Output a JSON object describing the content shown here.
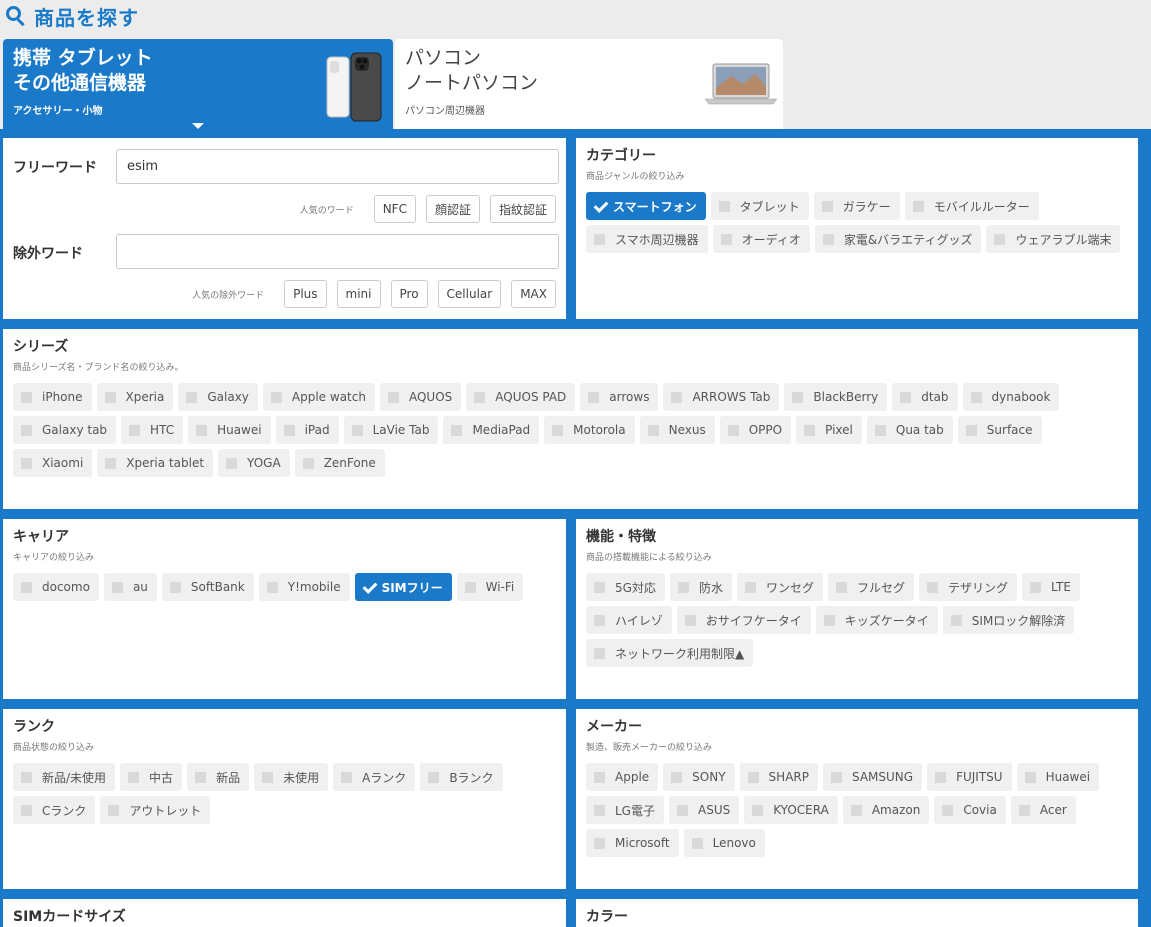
{
  "page": {
    "title": "商品を探す"
  },
  "tabs": [
    {
      "line1": "携帯 タブレット",
      "line2": "その他通信機器",
      "sub": "アクセサリー・小物"
    },
    {
      "line1": "パソコン",
      "line2": "ノートパソコン",
      "sub": "パソコン周辺機器"
    }
  ],
  "freeword": {
    "label": "フリーワード",
    "value": "esim",
    "popular_label": "人気のワード",
    "popular": [
      "NFC",
      "顔認証",
      "指紋認証"
    ],
    "exclude_label": "除外ワード",
    "exclude_value": "",
    "popular_exclude_label": "人気の除外ワード",
    "popular_exclude": [
      "Plus",
      "mini",
      "Pro",
      "Cellular",
      "MAX"
    ]
  },
  "sections": {
    "category": {
      "title": "カテゴリー",
      "sub": "商品ジャンルの絞り込み",
      "items": [
        {
          "label": "スマートフォン",
          "checked": true
        },
        {
          "label": "タブレット",
          "checked": false
        },
        {
          "label": "ガラケー",
          "checked": false
        },
        {
          "label": "モバイルルーター",
          "checked": false
        },
        {
          "label": "スマホ周辺機器",
          "checked": false
        },
        {
          "label": "オーディオ",
          "checked": false
        },
        {
          "label": "家電&バラエティグッズ",
          "checked": false
        },
        {
          "label": "ウェアラブル端末",
          "checked": false
        }
      ]
    },
    "series": {
      "title": "シリーズ",
      "sub": "商品シリーズ名・ブランド名の絞り込み。",
      "items": [
        {
          "label": "iPhone",
          "checked": false
        },
        {
          "label": "Xperia",
          "checked": false
        },
        {
          "label": "Galaxy",
          "checked": false
        },
        {
          "label": "Apple watch",
          "checked": false
        },
        {
          "label": "AQUOS",
          "checked": false
        },
        {
          "label": "AQUOS PAD",
          "checked": false
        },
        {
          "label": "arrows",
          "checked": false
        },
        {
          "label": "ARROWS Tab",
          "checked": false
        },
        {
          "label": "BlackBerry",
          "checked": false
        },
        {
          "label": "dtab",
          "checked": false
        },
        {
          "label": "dynabook",
          "checked": false
        },
        {
          "label": "Galaxy tab",
          "checked": false
        },
        {
          "label": "HTC",
          "checked": false
        },
        {
          "label": "Huawei",
          "checked": false
        },
        {
          "label": "iPad",
          "checked": false
        },
        {
          "label": "LaVie Tab",
          "checked": false
        },
        {
          "label": "MediaPad",
          "checked": false
        },
        {
          "label": "Motorola",
          "checked": false
        },
        {
          "label": "Nexus",
          "checked": false
        },
        {
          "label": "OPPO",
          "checked": false
        },
        {
          "label": "Pixel",
          "checked": false
        },
        {
          "label": "Qua tab",
          "checked": false
        },
        {
          "label": "Surface",
          "checked": false
        },
        {
          "label": "Xiaomi",
          "checked": false
        },
        {
          "label": "Xperia tablet",
          "checked": false
        },
        {
          "label": "YOGA",
          "checked": false
        },
        {
          "label": "ZenFone",
          "checked": false
        }
      ]
    },
    "carrier": {
      "title": "キャリア",
      "sub": "キャリアの絞り込み",
      "items": [
        {
          "label": "docomo",
          "checked": false
        },
        {
          "label": "au",
          "checked": false
        },
        {
          "label": "SoftBank",
          "checked": false
        },
        {
          "label": "Y!mobile",
          "checked": false
        },
        {
          "label": "SIMフリー",
          "checked": true
        },
        {
          "label": "Wi-Fi",
          "checked": false
        }
      ]
    },
    "features": {
      "title": "機能・特徴",
      "sub": "商品の搭載機能による絞り込み",
      "items": [
        {
          "label": "5G対応",
          "checked": false
        },
        {
          "label": "防水",
          "checked": false
        },
        {
          "label": "ワンセグ",
          "checked": false
        },
        {
          "label": "フルセグ",
          "checked": false
        },
        {
          "label": "テザリング",
          "checked": false
        },
        {
          "label": "LTE",
          "checked": false
        },
        {
          "label": "ハイレゾ",
          "checked": false
        },
        {
          "label": "おサイフケータイ",
          "checked": false
        },
        {
          "label": "キッズケータイ",
          "checked": false
        },
        {
          "label": "SIMロック解除済",
          "checked": false
        },
        {
          "label": "ネットワーク利用制限▲",
          "checked": false
        }
      ]
    },
    "rank": {
      "title": "ランク",
      "sub": "商品状態の絞り込み",
      "items": [
        {
          "label": "新品/未使用",
          "checked": false
        },
        {
          "label": "中古",
          "checked": false
        },
        {
          "label": "新品",
          "checked": false
        },
        {
          "label": "未使用",
          "checked": false
        },
        {
          "label": "Aランク",
          "checked": false
        },
        {
          "label": "Bランク",
          "checked": false
        },
        {
          "label": "Cランク",
          "checked": false
        },
        {
          "label": "アウトレット",
          "checked": false
        }
      ]
    },
    "maker": {
      "title": "メーカー",
      "sub": "製造、販売メーカーの絞り込み",
      "items": [
        {
          "label": "Apple",
          "checked": false
        },
        {
          "label": "SONY",
          "checked": false
        },
        {
          "label": "SHARP",
          "checked": false
        },
        {
          "label": "SAMSUNG",
          "checked": false
        },
        {
          "label": "FUJITSU",
          "checked": false
        },
        {
          "label": "Huawei",
          "checked": false
        },
        {
          "label": "LG電子",
          "checked": false
        },
        {
          "label": "ASUS",
          "checked": false
        },
        {
          "label": "KYOCERA",
          "checked": false
        },
        {
          "label": "Amazon",
          "checked": false
        },
        {
          "label": "Covia",
          "checked": false
        },
        {
          "label": "Acer",
          "checked": false
        },
        {
          "label": "Microsoft",
          "checked": false
        },
        {
          "label": "Lenovo",
          "checked": false
        }
      ]
    },
    "simsize": {
      "title": "SIMカードサイズ"
    },
    "color": {
      "title": "カラー"
    }
  },
  "colors": {
    "accent": "#1a7ac9",
    "chip_bg": "#f0f0f0"
  },
  "icons": {
    "title": "search-icon",
    "selected": "check-icon",
    "unselected": "checkbox-icon",
    "tab_caret": "caret-down-icon"
  }
}
